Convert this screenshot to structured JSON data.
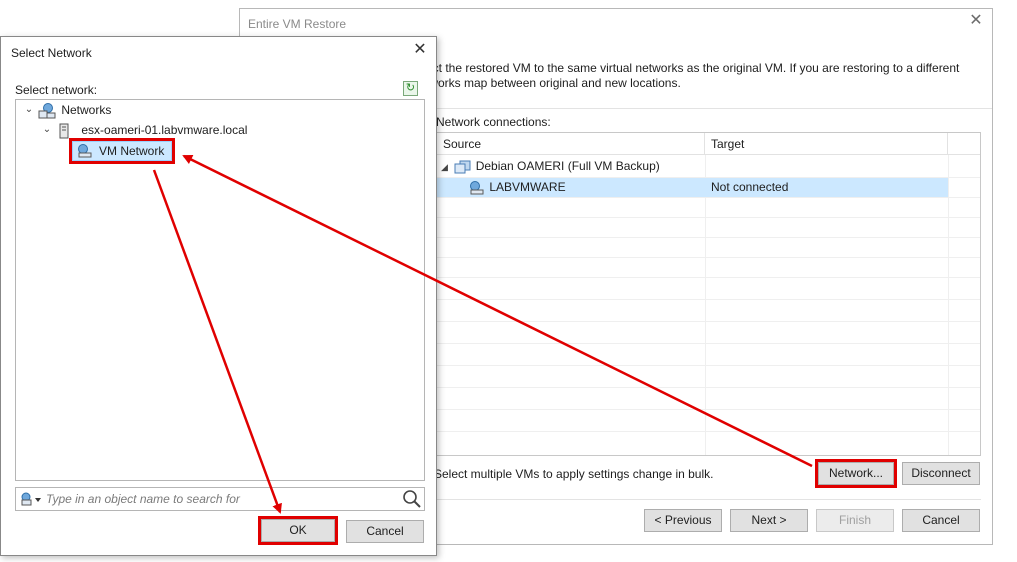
{
  "wizard": {
    "title": "Entire VM Restore",
    "description": "ect the restored VM to the same virtual networks as the original VM. If you are restoring to a different\ntworks map between original and new locations.",
    "connections_label": "Network connections:",
    "columns": {
      "source": "Source",
      "target": "Target"
    },
    "vm_row": {
      "label": "Debian OAMERI (Full VM Backup)"
    },
    "network_row": {
      "source": "LABVMWARE",
      "target": "Not connected"
    },
    "bulk_note": "Select multiple VMs to apply settings change in bulk.",
    "buttons": {
      "network": "Network...",
      "disconnect": "Disconnect",
      "previous": "< Previous",
      "next": "Next >",
      "finish": "Finish",
      "cancel": "Cancel"
    }
  },
  "dialog": {
    "title": "Select Network",
    "select_label": "Select network:",
    "tree": {
      "root": "Networks",
      "host": "esx-oameri-01.labvmware.local",
      "network": "VM Network"
    },
    "search_placeholder": "Type in an object name to search for",
    "buttons": {
      "ok": "OK",
      "cancel": "Cancel"
    }
  },
  "colors": {
    "highlight": "#e00000",
    "selection": "#cce8ff",
    "arrow": "#e00000"
  }
}
